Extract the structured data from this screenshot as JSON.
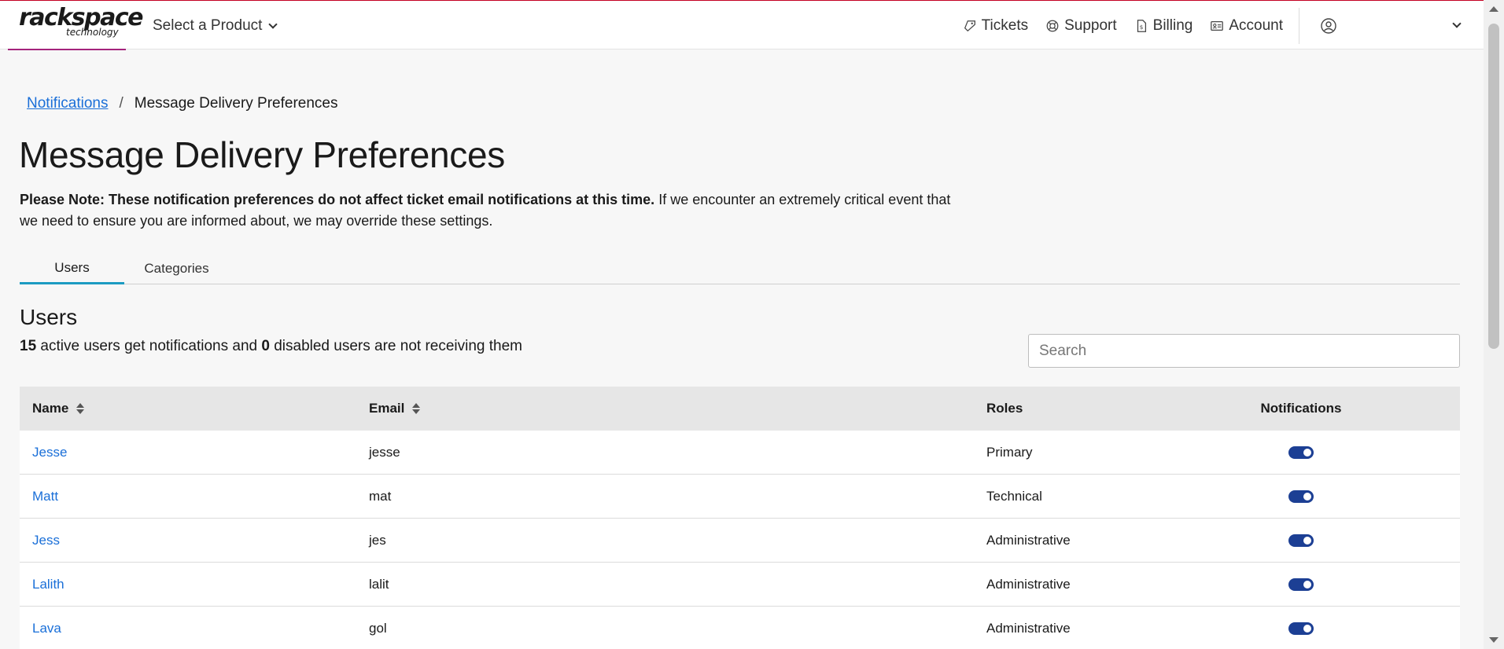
{
  "header": {
    "logo_main": "rackspace",
    "logo_sub": "technology",
    "product_select": "Select a Product",
    "nav": [
      {
        "label": "Tickets",
        "icon": "ticket-icon"
      },
      {
        "label": "Support",
        "icon": "support-icon"
      },
      {
        "label": "Billing",
        "icon": "billing-icon"
      },
      {
        "label": "Account",
        "icon": "account-icon"
      }
    ]
  },
  "breadcrumb": {
    "parent": "Notifications",
    "separator": "/",
    "current": "Message Delivery Preferences"
  },
  "page": {
    "title": "Message Delivery Preferences",
    "note_bold": "Please Note: These notification preferences do not affect ticket email notifications at this time.",
    "note_rest": " If we encounter an extremely critical event that we need to ensure you are informed about, we may override these settings."
  },
  "tabs": [
    {
      "label": "Users",
      "active": true
    },
    {
      "label": "Categories",
      "active": false
    }
  ],
  "users_section": {
    "title": "Users",
    "active_count": "15",
    "active_text": " active users get notifications and ",
    "disabled_count": "0",
    "disabled_text": " disabled users are not receiving them",
    "search_placeholder": "Search"
  },
  "table": {
    "columns": [
      "Name",
      "Email",
      "Roles",
      "Notifications"
    ],
    "rows": [
      {
        "name": "Jesse",
        "email": "jesse",
        "role": "Primary",
        "notifications": true
      },
      {
        "name": "Matt",
        "email": "mat",
        "role": "Technical",
        "notifications": true
      },
      {
        "name": "Jess",
        "email": "jes",
        "role": "Administrative",
        "notifications": true
      },
      {
        "name": "Lalith",
        "email": "lalit",
        "role": "Administrative",
        "notifications": true
      },
      {
        "name": "Lava",
        "email": "gol",
        "role": "Administrative",
        "notifications": true
      }
    ]
  },
  "colors": {
    "link": "#1a6fd8",
    "toggle_on": "#1c3f94",
    "tab_active": "#1c9bc2",
    "brand_accent": "#a4237c"
  }
}
